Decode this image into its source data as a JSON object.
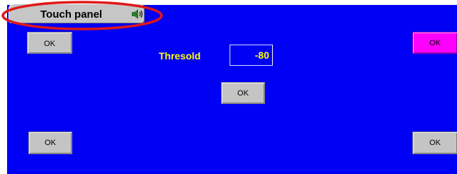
{
  "title_tab": {
    "label": "Touch panel",
    "icon": "speaker-icon"
  },
  "buttons": {
    "top_left": "OK",
    "top_right": "OK",
    "center": "OK",
    "bottom_left": "OK",
    "bottom_right": "OK"
  },
  "threshold": {
    "label": "Thresold",
    "value": "-80"
  },
  "colors": {
    "panel_background": "#0000f4",
    "label_text": "#ffff00",
    "button_gray": "#c4c4c4",
    "button_magenta": "#ff00ff",
    "highlight_ellipse": "#e01818"
  }
}
